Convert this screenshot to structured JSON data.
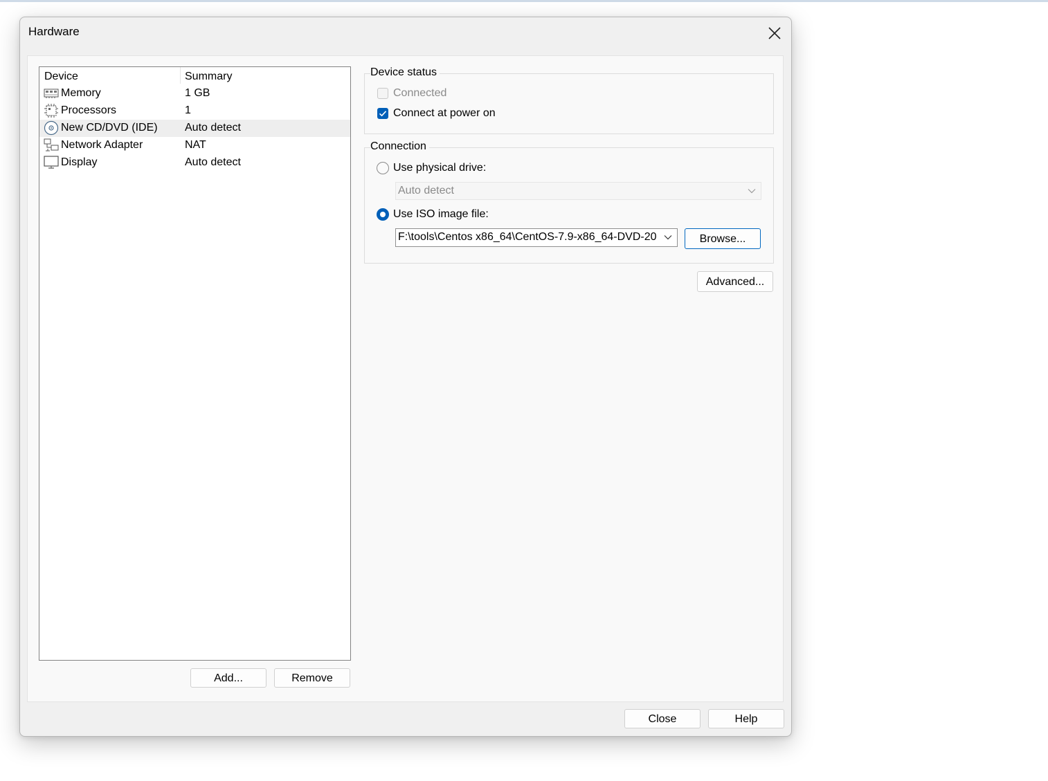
{
  "window": {
    "title": "Hardware"
  },
  "device_list": {
    "columns": [
      "Device",
      "Summary"
    ],
    "rows": [
      {
        "icon": "memory-icon",
        "name": "Memory",
        "summary": "1 GB"
      },
      {
        "icon": "processor-icon",
        "name": "Processors",
        "summary": "1"
      },
      {
        "icon": "cd-dvd-icon",
        "name": "New CD/DVD (IDE)",
        "summary": "Auto detect",
        "selected": true
      },
      {
        "icon": "network-adapter-icon",
        "name": "Network Adapter",
        "summary": "NAT"
      },
      {
        "icon": "display-icon",
        "name": "Display",
        "summary": "Auto detect"
      }
    ]
  },
  "device_status": {
    "title": "Device status",
    "connected_label": "Connected",
    "connected_checked": false,
    "connected_enabled": false,
    "power_on_label": "Connect at power on",
    "power_on_checked": true
  },
  "connection": {
    "title": "Connection",
    "physical_label": "Use physical drive:",
    "physical_selected": false,
    "physical_value": "Auto detect",
    "iso_label": "Use ISO image file:",
    "iso_selected": true,
    "iso_path": "F:\\tools\\Centos x86_64\\CentOS-7.9-x86_64-DVD-20",
    "browse_label": "Browse..."
  },
  "buttons": {
    "advanced": "Advanced...",
    "add": "Add...",
    "remove": "Remove",
    "close": "Close",
    "help": "Help"
  },
  "colors": {
    "accent": "#005fb8",
    "dialog_bg": "#f0f0f0",
    "panel_bg": "#f9f9f9"
  }
}
